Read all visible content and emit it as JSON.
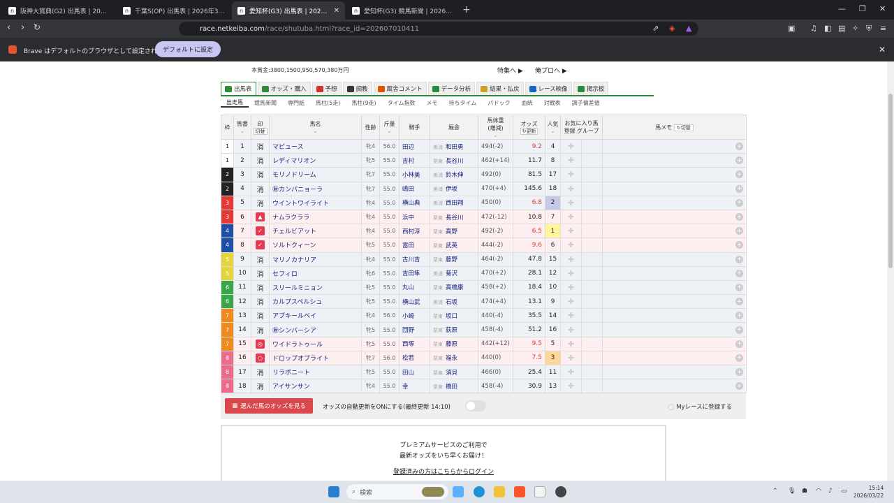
{
  "browser": {
    "tabs": [
      {
        "title": "阪神大賞典(G2) 出馬表 | 2026年3月2",
        "active": false
      },
      {
        "title": "千葉S(OP) 出馬表 | 2026年3月22日",
        "active": false
      },
      {
        "title": "愛知杯(G3) 出馬表 | 2026年3月2",
        "active": true
      },
      {
        "title": "愛知杯(G3) 競馬新聞 | 2026年3月22",
        "active": false
      }
    ],
    "url_host": "race.netkeiba.com",
    "url_path": "/race/shutuba.html?race_id=202607010411",
    "infobar_message": "Brave はデフォルトのブラウザとして設定されていません",
    "infobar_button": "デフォルトに設定"
  },
  "race": {
    "prize": "本賞金:3800,1500,950,570,380万円",
    "feature_link": "特集へ ▶",
    "pro_link": "俺プロへ ▶"
  },
  "main_tabs": [
    "出馬表",
    "オッズ・購入",
    "予想",
    "調教",
    "厩舎コメント",
    "データ分析",
    "結果・払戻",
    "レース映像",
    "掲示板"
  ],
  "main_tab_colors": [
    "#2d8a3a",
    "#2d8a3a",
    "#d32f2f",
    "#333",
    "#e65100",
    "#2d8a3a",
    "#c9a227",
    "#1565c0",
    "#2d8a3a"
  ],
  "sub_tabs": [
    "出走馬",
    "競馬新聞",
    "専門紙",
    "馬柱(5走)",
    "馬柱(9走)",
    "タイム指数",
    "メモ",
    "持ちタイム",
    "パドック",
    "血統",
    "対戦表",
    "調子偏差値"
  ],
  "table_headers": {
    "waku": "枠",
    "umaban": "馬番",
    "mark": "印",
    "mark_toggle": "切替",
    "name": "馬名",
    "sexage": "性齢",
    "weight": "斤量",
    "jockey": "騎手",
    "trainer": "厩舎",
    "bodyweight": "馬体重",
    "bodyweight_sub": "(増減)",
    "odds": "オッズ",
    "odds_refresh": "更新",
    "pop": "人気",
    "fav": "お気に入り馬",
    "fav_reg": "登録",
    "fav_group": "グループ",
    "memo": "馬メモ",
    "memo_toggle": "切替"
  },
  "horses": [
    {
      "waku": "1",
      "umaban": "1",
      "mark": "消",
      "name": "マピュース",
      "sex": "牝4",
      "kg": "56.0",
      "jockey": "田辺",
      "area": "美浦",
      "trainer": "和田勇",
      "bw": "494(-2)",
      "odds": "9.2",
      "pop": "4",
      "row": "blue",
      "waku_color": "#ffffff",
      "waku_text": "#222",
      "odds_hot": true
    },
    {
      "waku": "1",
      "umaban": "2",
      "mark": "消",
      "name": "レディマリオン",
      "sex": "牝5",
      "kg": "55.0",
      "jockey": "吉村",
      "area": "栗東",
      "trainer": "長谷川",
      "bw": "462(+14)",
      "odds": "11.7",
      "pop": "8",
      "row": "blue",
      "waku_color": "#ffffff",
      "waku_text": "#222",
      "odds_hot": false
    },
    {
      "waku": "2",
      "umaban": "3",
      "mark": "消",
      "name": "モリノドリーム",
      "sex": "牝7",
      "kg": "55.0",
      "jockey": "小林美",
      "area": "美浦",
      "trainer": "鈴木伸",
      "bw": "492(0)",
      "odds": "81.5",
      "pop": "17",
      "row": "blue",
      "waku_color": "#222222",
      "waku_text": "#fff",
      "odds_hot": false
    },
    {
      "waku": "2",
      "umaban": "4",
      "mark": "消",
      "name": "㊖カンパニョーラ",
      "sex": "牝7",
      "kg": "55.0",
      "jockey": "嶋田",
      "area": "美浦",
      "trainer": "伊坂",
      "bw": "470(+4)",
      "odds": "145.6",
      "pop": "18",
      "row": "blue",
      "waku_color": "#222222",
      "waku_text": "#fff",
      "odds_hot": false
    },
    {
      "waku": "3",
      "umaban": "5",
      "mark": "消",
      "name": "ウイントワイライト",
      "sex": "牝4",
      "kg": "55.0",
      "jockey": "横山典",
      "area": "美浦",
      "trainer": "西田翔",
      "bw": "450(0)",
      "odds": "6.8",
      "pop": "2",
      "row": "blue",
      "waku_color": "#e53935",
      "waku_text": "#fff",
      "odds_hot": true,
      "pop_class": "p2"
    },
    {
      "waku": "3",
      "umaban": "6",
      "mark": "▲",
      "name": "ナムラクララ",
      "sex": "牝4",
      "kg": "55.0",
      "jockey": "浜中",
      "area": "栗東",
      "trainer": "長谷川",
      "bw": "472(-12)",
      "odds": "10.8",
      "pop": "7",
      "row": "pink",
      "waku_color": "#e53935",
      "waku_text": "#fff",
      "odds_hot": false
    },
    {
      "waku": "4",
      "umaban": "7",
      "mark": "✓",
      "name": "チェルビアット",
      "sex": "牝4",
      "kg": "55.0",
      "jockey": "西村淳",
      "area": "栗東",
      "trainer": "高野",
      "bw": "492(-2)",
      "odds": "6.5",
      "pop": "1",
      "row": "pink",
      "waku_color": "#1e4fa8",
      "waku_text": "#fff",
      "odds_hot": true,
      "pop_class": "p1"
    },
    {
      "waku": "4",
      "umaban": "8",
      "mark": "✓",
      "name": "ソルトクィーン",
      "sex": "牝5",
      "kg": "55.0",
      "jockey": "富田",
      "area": "栗東",
      "trainer": "武英",
      "bw": "444(-2)",
      "odds": "9.6",
      "pop": "6",
      "row": "pink",
      "waku_color": "#1e4fa8",
      "waku_text": "#fff",
      "odds_hot": true
    },
    {
      "waku": "5",
      "umaban": "9",
      "mark": "消",
      "name": "マリノカナリア",
      "sex": "牝4",
      "kg": "55.0",
      "jockey": "古川吉",
      "area": "栗東",
      "trainer": "藤野",
      "bw": "464(-2)",
      "odds": "47.8",
      "pop": "15",
      "row": "blue",
      "waku_color": "#e6d53a",
      "waku_text": "#fff",
      "odds_hot": false
    },
    {
      "waku": "5",
      "umaban": "10",
      "mark": "消",
      "name": "セフィロ",
      "sex": "牝6",
      "kg": "55.0",
      "jockey": "吉田隼",
      "area": "美浦",
      "trainer": "菊沢",
      "bw": "470(+2)",
      "odds": "28.1",
      "pop": "12",
      "row": "blue",
      "waku_color": "#e6d53a",
      "waku_text": "#fff",
      "odds_hot": false
    },
    {
      "waku": "6",
      "umaban": "11",
      "mark": "消",
      "name": "スリールミニョン",
      "sex": "牝5",
      "kg": "55.0",
      "jockey": "丸山",
      "area": "栗東",
      "trainer": "高橋康",
      "bw": "458(+2)",
      "odds": "18.4",
      "pop": "10",
      "row": "blue",
      "waku_color": "#3aa64a",
      "waku_text": "#fff",
      "odds_hot": false
    },
    {
      "waku": "6",
      "umaban": "12",
      "mark": "消",
      "name": "カルプスペルシュ",
      "sex": "牝5",
      "kg": "55.0",
      "jockey": "横山武",
      "area": "美浦",
      "trainer": "石坂",
      "bw": "474(+4)",
      "odds": "13.1",
      "pop": "9",
      "row": "blue",
      "waku_color": "#3aa64a",
      "waku_text": "#fff",
      "odds_hot": false
    },
    {
      "waku": "7",
      "umaban": "13",
      "mark": "消",
      "name": "アブキールベイ",
      "sex": "牝4",
      "kg": "56.0",
      "jockey": "小崎",
      "area": "栗東",
      "trainer": "坂口",
      "bw": "440(-4)",
      "odds": "35.5",
      "pop": "14",
      "row": "blue",
      "waku_color": "#ef8a1f",
      "waku_text": "#fff",
      "odds_hot": false
    },
    {
      "waku": "7",
      "umaban": "14",
      "mark": "消",
      "name": "㊖シンバーシア",
      "sex": "牝5",
      "kg": "55.0",
      "jockey": "団野",
      "area": "栗東",
      "trainer": "荻原",
      "bw": "458(-4)",
      "odds": "51.2",
      "pop": "16",
      "row": "blue",
      "waku_color": "#ef8a1f",
      "waku_text": "#fff",
      "odds_hot": false
    },
    {
      "waku": "7",
      "umaban": "15",
      "mark": "◎",
      "name": "ワイドラトゥール",
      "sex": "牝5",
      "kg": "55.0",
      "jockey": "西塚",
      "area": "栗東",
      "trainer": "藤原",
      "bw": "442(+12)",
      "odds": "9.5",
      "pop": "5",
      "row": "pink",
      "waku_color": "#ef8a1f",
      "waku_text": "#fff",
      "odds_hot": true
    },
    {
      "waku": "8",
      "umaban": "16",
      "mark": "○",
      "name": "ドロップオブライト",
      "sex": "牝7",
      "kg": "56.0",
      "jockey": "松若",
      "area": "栗東",
      "trainer": "福永",
      "bw": "440(0)",
      "odds": "7.5",
      "pop": "3",
      "row": "pink",
      "waku_color": "#ec6b8a",
      "waku_text": "#fff",
      "odds_hot": true,
      "pop_class": "p3"
    },
    {
      "waku": "8",
      "umaban": "17",
      "mark": "消",
      "name": "リラボニート",
      "sex": "牝5",
      "kg": "55.0",
      "jockey": "田山",
      "area": "栗東",
      "trainer": "須貝",
      "bw": "466(0)",
      "odds": "25.4",
      "pop": "11",
      "row": "blue",
      "waku_color": "#ec6b8a",
      "waku_text": "#fff",
      "odds_hot": false
    },
    {
      "waku": "8",
      "umaban": "18",
      "mark": "消",
      "name": "アイサンサン",
      "sex": "牝4",
      "kg": "55.0",
      "jockey": "幸",
      "area": "栗東",
      "trainer": "橋田",
      "bw": "458(-4)",
      "odds": "30.9",
      "pop": "13",
      "row": "blue",
      "waku_color": "#ec6b8a",
      "waku_text": "#fff",
      "odds_hot": false
    }
  ],
  "bottom": {
    "view_button": "選んだ馬のオッズを見る",
    "auto_update": "オッズの自動更新をONにする(最終更新 14:10)",
    "myrace": "Myレースに登録する"
  },
  "premium": {
    "line1": "プレミアムサービスのご利用で",
    "line2": "最新オッズをいち早くお届け！",
    "login": "登録済みの方はこちらからログイン"
  },
  "taskbar": {
    "search_placeholder": "検索",
    "time": "15:14",
    "date": "2026/03/22"
  }
}
